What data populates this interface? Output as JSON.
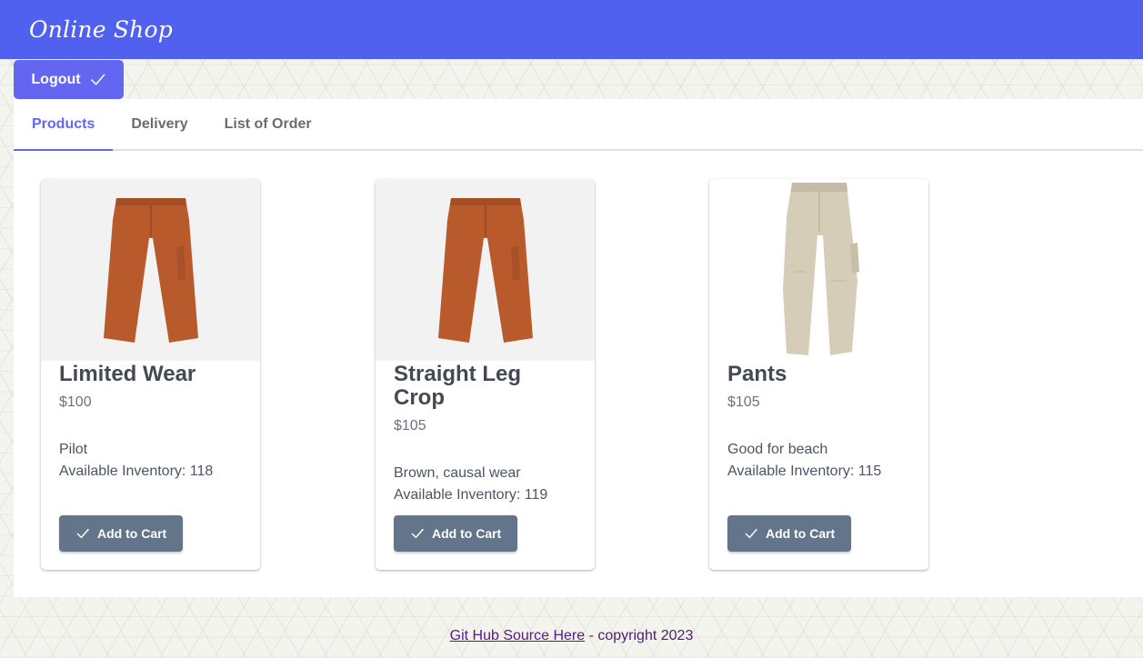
{
  "header": {
    "title": "Online Shop",
    "color": "#5061f0"
  },
  "logout": {
    "label": "Logout",
    "icon": "check-icon"
  },
  "tabs": [
    {
      "label": "Products",
      "active": true
    },
    {
      "label": "Delivery",
      "active": false
    },
    {
      "label": "List of Order",
      "active": false
    }
  ],
  "products": [
    {
      "name": "Limited Wear",
      "price": "$100",
      "description": "Pilot",
      "inventory": "Available Inventory: 118",
      "image": "rust-pants-image",
      "cart_label": "Add to Cart"
    },
    {
      "name": "Straight Leg Crop",
      "price": "$105",
      "description": "Brown, causal wear",
      "inventory": "Available Inventory: 119",
      "image": "rust-pants-image",
      "cart_label": "Add to Cart"
    },
    {
      "name": "Pants",
      "price": "$105",
      "description": "Good for beach",
      "inventory": "Available Inventory: 115",
      "image": "beige-pants-image",
      "cart_label": "Add to Cart"
    }
  ],
  "footer": {
    "link_text": "Git Hub Source Here",
    "suffix": " - copyright 2023"
  },
  "colors": {
    "accent": "#6366f1",
    "cart_button": "#64748b",
    "rust": "#b85a2b",
    "beige": "#d6cdb8"
  }
}
